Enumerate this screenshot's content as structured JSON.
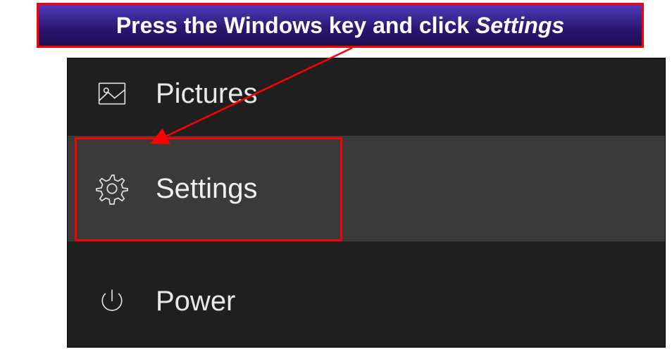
{
  "instruction": {
    "prefix": "Press the Windows key and click ",
    "emphasis": "Settings"
  },
  "menu": {
    "pictures": {
      "label": "Pictures"
    },
    "settings": {
      "label": "Settings"
    },
    "power": {
      "label": "Power"
    }
  }
}
